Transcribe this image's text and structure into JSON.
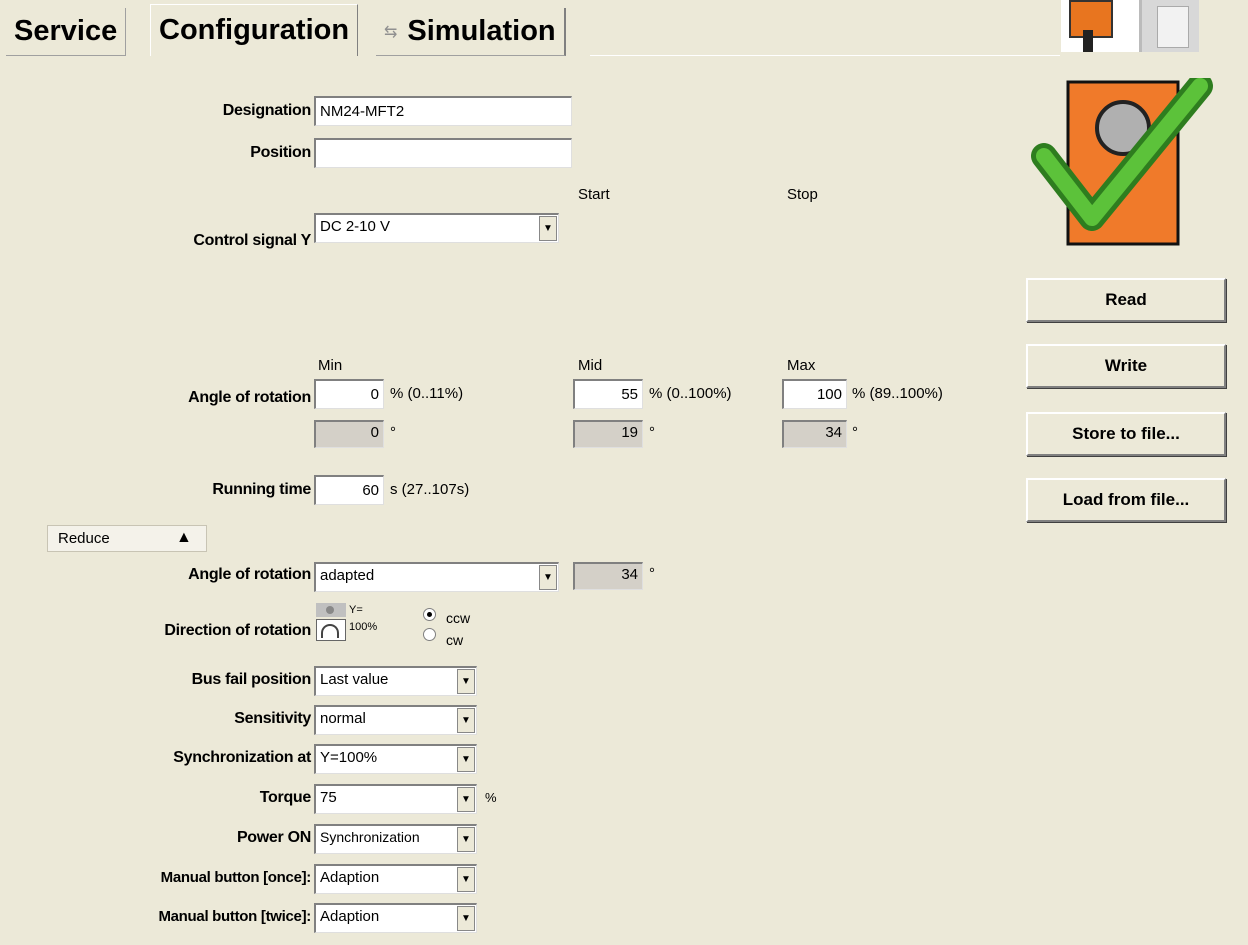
{
  "tabs": {
    "service": "Service",
    "configuration": "Configuration",
    "simulation": "Simulation"
  },
  "designation": {
    "label": "Designation",
    "value": "NM24-MFT2"
  },
  "position": {
    "label": "Position",
    "value": ""
  },
  "start_stop": {
    "start": "Start",
    "stop": "Stop"
  },
  "control_signal": {
    "label": "Control signal Y",
    "value": "DC 2-10 V"
  },
  "angle_headers": {
    "min": "Min",
    "mid": "Mid",
    "max": "Max"
  },
  "angle_of_rotation": {
    "label": "Angle of rotation",
    "min_pct": "0",
    "min_range": "% (0..11%)",
    "min_deg": "0",
    "mid_pct": "55",
    "mid_range": "% (0..100%)",
    "mid_deg": "19",
    "max_pct": "100",
    "max_range": "% (89..100%)",
    "max_deg": "34",
    "deg_unit": "°"
  },
  "running_time": {
    "label": "Running time",
    "value": "60",
    "range": "s  (27..107s)"
  },
  "reduce": {
    "label": "Reduce",
    "arrow": "▲"
  },
  "angle_mode": {
    "label": "Angle of rotation",
    "value": "adapted",
    "deg": "34",
    "deg_unit": "°"
  },
  "direction": {
    "label": "Direction of rotation",
    "icon_text_1": "Y=",
    "icon_text_2": "100%",
    "ccw": "ccw",
    "cw": "cw",
    "selected": "ccw"
  },
  "bus_fail": {
    "label": "Bus fail position",
    "value": "Last value"
  },
  "sensitivity": {
    "label": "Sensitivity",
    "value": "normal"
  },
  "sync": {
    "label": "Synchronization at",
    "value": "Y=100%"
  },
  "torque": {
    "label": "Torque",
    "value": "75",
    "unit": "%"
  },
  "power_on": {
    "label": "Power ON",
    "value": "Synchronization"
  },
  "manual_once": {
    "label": "Manual button [once]:",
    "value": "Adaption"
  },
  "manual_twice": {
    "label": "Manual button [twice]:",
    "value": "Adaption"
  },
  "buttons": {
    "read": "Read",
    "write": "Write",
    "store": "Store to file...",
    "load": "Load from file..."
  },
  "colors": {
    "background": "#ece9d8",
    "actuator_orange": "#f07a2a",
    "check_green": "#4caf2f"
  }
}
